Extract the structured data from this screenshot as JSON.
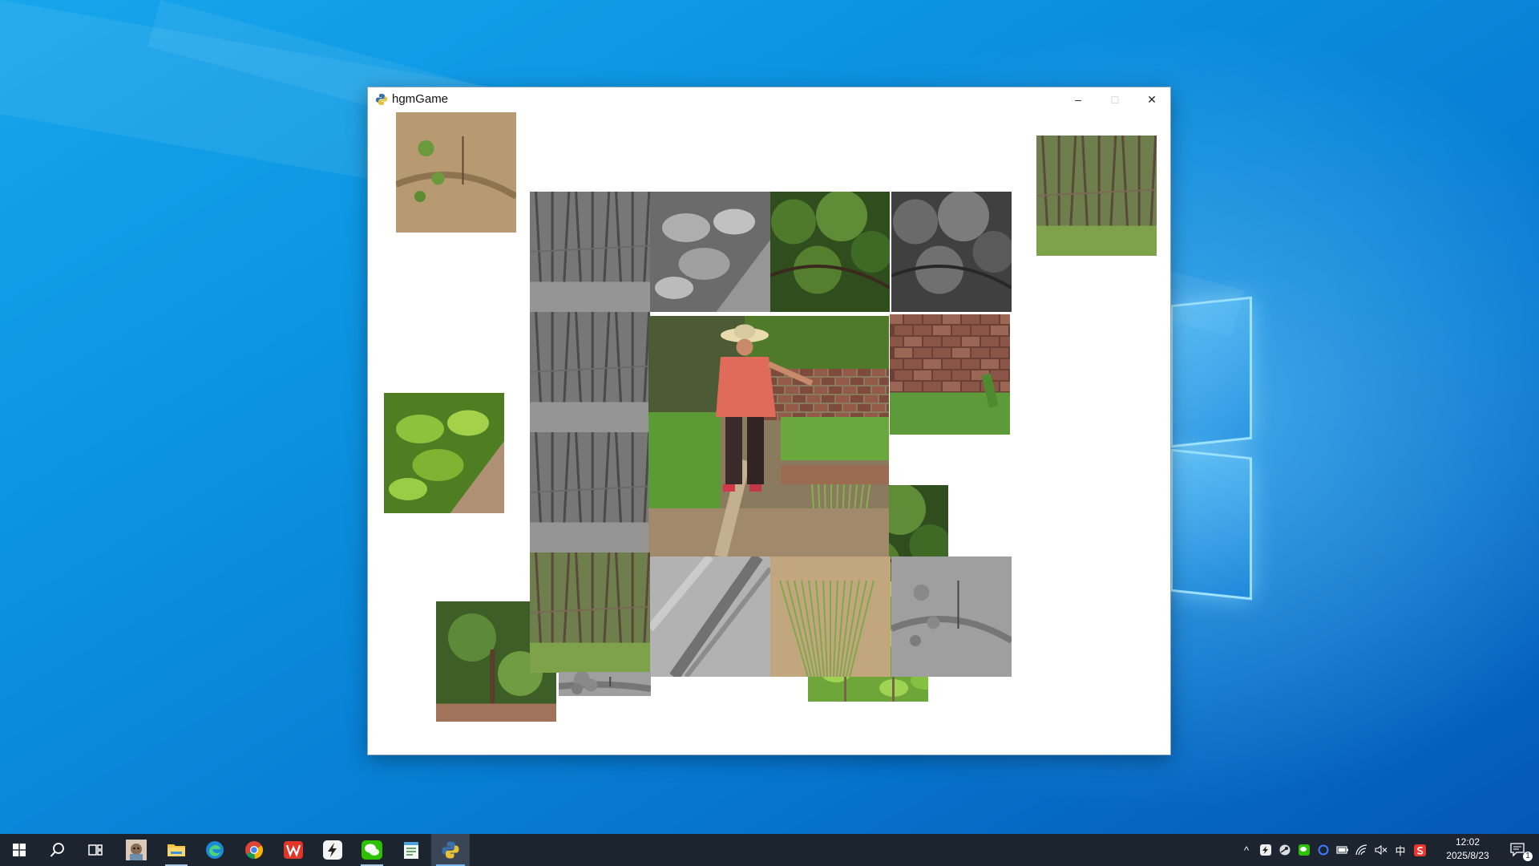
{
  "window": {
    "title": "hgmGame",
    "icon": "python-snake-icon",
    "controls": {
      "minimize": "–",
      "maximize": "□",
      "close": "✕"
    }
  },
  "game": {
    "tiles": [
      {
        "name": "tile-soil-seedlings",
        "grayscale": false,
        "scene": "soil"
      },
      {
        "name": "tile-bean-leaves",
        "grayscale": false,
        "scene": "leaves"
      },
      {
        "name": "tile-bamboo-stakes",
        "grayscale": false,
        "scene": "stakes"
      },
      {
        "name": "tile-dirt-furrow",
        "grayscale": false,
        "scene": "furrow"
      },
      {
        "name": "tile-tree-foliage",
        "grayscale": false,
        "scene": "foliage"
      },
      {
        "name": "tile-climbing-beans",
        "grayscale": false,
        "scene": "beans"
      },
      {
        "name": "tile-peach-tree",
        "grayscale": false,
        "scene": "tree"
      },
      {
        "name": "tile-grid-stakes",
        "grayscale": true,
        "scene": "stakes"
      },
      {
        "name": "tile-grid-vines",
        "grayscale": true,
        "scene": "stakes"
      },
      {
        "name": "tile-grid-tree-top",
        "grayscale": false,
        "scene": "foliage"
      },
      {
        "name": "tile-grid-tree-right",
        "grayscale": true,
        "scene": "foliage"
      },
      {
        "name": "tile-grid-trellis",
        "grayscale": true,
        "scene": "stakes"
      },
      {
        "name": "tile-grid-center-person",
        "grayscale": false,
        "scene": "person"
      },
      {
        "name": "tile-grid-brick-wall",
        "grayscale": false,
        "scene": "bricks"
      },
      {
        "name": "tile-grid-leaves-gray",
        "grayscale": true,
        "scene": "leaves"
      },
      {
        "name": "tile-grid-trellis-low",
        "grayscale": false,
        "scene": "stakes"
      },
      {
        "name": "tile-grid-furrow-gray",
        "grayscale": true,
        "scene": "furrow"
      },
      {
        "name": "tile-grid-onions",
        "grayscale": false,
        "scene": "onions"
      },
      {
        "name": "tile-grid-soil-gray",
        "grayscale": true,
        "scene": "soil"
      },
      {
        "name": "tile-grid-small-gray",
        "grayscale": true,
        "scene": "soil"
      }
    ]
  },
  "taskbar": {
    "apps": [
      {
        "name": "start-button",
        "icon": "windows-start-icon"
      },
      {
        "name": "search-button",
        "icon": "search-icon"
      },
      {
        "name": "task-view-button",
        "icon": "task-view-icon"
      },
      {
        "name": "taskbar-app-avatar",
        "icon": "dog-avatar-icon"
      },
      {
        "name": "taskbar-app-file-explorer",
        "icon": "folder-icon"
      },
      {
        "name": "taskbar-app-edge",
        "icon": "edge-icon"
      },
      {
        "name": "taskbar-app-chrome",
        "icon": "chrome-icon"
      },
      {
        "name": "taskbar-app-wps",
        "icon": "wps-icon"
      },
      {
        "name": "taskbar-app-bolt",
        "icon": "lightning-icon"
      },
      {
        "name": "taskbar-app-wechat",
        "icon": "wechat-icon"
      },
      {
        "name": "taskbar-app-notepad",
        "icon": "notepad-icon"
      },
      {
        "name": "taskbar-app-python-game",
        "icon": "python-snake-icon"
      }
    ],
    "tray": {
      "chevron": "^",
      "ime": "中",
      "clock_time": "12:02",
      "clock_date": "2025/8/23",
      "notification_count": "1"
    }
  }
}
